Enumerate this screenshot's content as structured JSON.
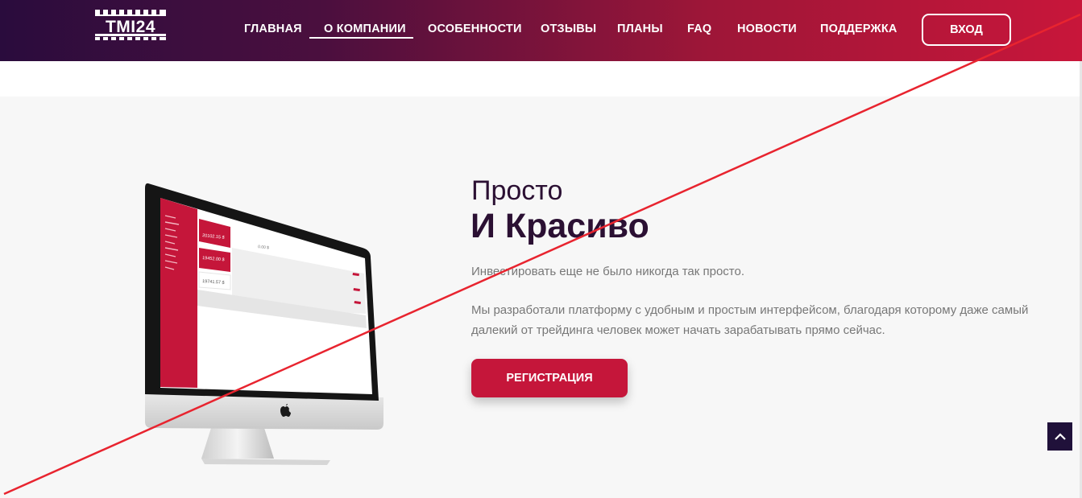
{
  "header": {
    "logo_text": "TMI24",
    "nav": [
      {
        "label": "ГЛАВНАЯ"
      },
      {
        "label": "О КОМПАНИИ",
        "active": true
      },
      {
        "label": "ОСОБЕННОСТИ"
      },
      {
        "label": "ОТЗЫВЫ"
      },
      {
        "label": "ПЛАНЫ"
      },
      {
        "label": "FAQ"
      },
      {
        "label": "НОВОСТИ"
      },
      {
        "label": "ПОДДЕРЖКА"
      }
    ],
    "login_label": "ВХОД"
  },
  "hero": {
    "headline_light": "Просто",
    "headline_bold": "И Красиво",
    "paragraph_1": "Инвестировать еще не было никогда так просто.",
    "paragraph_2": "Мы разработали платформу с удобным и простым интерфейсом, благодаря которому даже самый далекий от трейдинга человек может начать зарабатывать прямо сейчас.",
    "register_label": "РЕГИСТРАЦИЯ"
  },
  "dashboard_mock": {
    "values": [
      "20102.15 $",
      "19452.00 $",
      "19741.57 $",
      "0.00 $"
    ]
  },
  "colors": {
    "accent": "#c5163a",
    "dark": "#2b1033",
    "strike_line": "#e8242f"
  },
  "icons": {
    "scroll_top": "chevron-up-icon",
    "monitor_brand": "apple-logo-icon"
  }
}
